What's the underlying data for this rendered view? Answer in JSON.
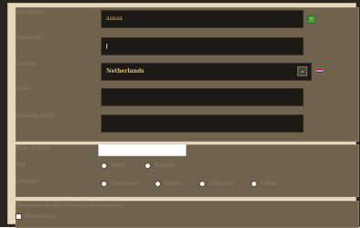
{
  "form": {
    "username_label": "Username",
    "username_value": "aaaaa",
    "password_label": "Password",
    "password_value": "",
    "country_label": "Country",
    "country_value": "Netherlands",
    "email_label": "Email",
    "email_value": "",
    "email_confirm_label": "Confirm email",
    "email_confirm_value": "",
    "birthday_label": "Date of birth",
    "birthday_value": "",
    "gender_label": "Sex",
    "gender_options": [
      "Male",
      "Female"
    ],
    "category_label": "Category",
    "category_options": [
      "Customer",
      "Dealer",
      "Collector",
      "Other"
    ],
    "newsletter_label": "Subscribe to the following newsletters:",
    "newsletter_option": "Newsletter"
  },
  "icons": {
    "username_check": "check-icon",
    "country_flag": "netherlands-flag-icon",
    "dropdown": "chevron-down-icon"
  }
}
